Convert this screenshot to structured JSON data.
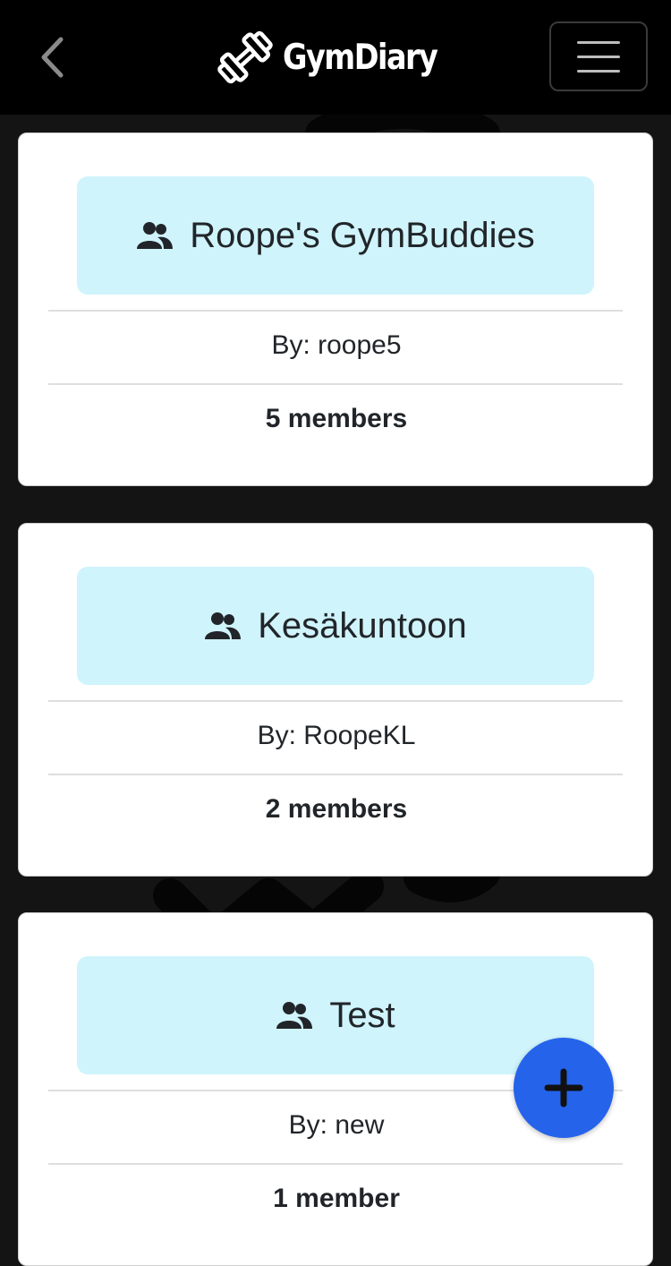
{
  "navbar": {
    "brand_name": "GymDiary",
    "back_icon": "chevron-left-icon",
    "brand_icon": "dumbbell-icon",
    "menu_icon": "hamburger-menu-icon"
  },
  "groups": [
    {
      "name": "Roope's GymBuddies",
      "creator": "By: roope5",
      "members": "5 members",
      "icon": "users-icon"
    },
    {
      "name": "Kesäkuntoon",
      "creator": "By: RoopeKL",
      "members": "2 members",
      "icon": "users-icon"
    },
    {
      "name": "Test",
      "creator": "By: new",
      "members": "1 member",
      "icon": "users-icon"
    }
  ],
  "fab": {
    "icon": "plus-icon",
    "color": "#2563eb"
  },
  "colors": {
    "navbar_bg": "#000000",
    "page_bg": "#141414",
    "title_box_bg": "#cff4fc",
    "accent": "#2563eb"
  }
}
